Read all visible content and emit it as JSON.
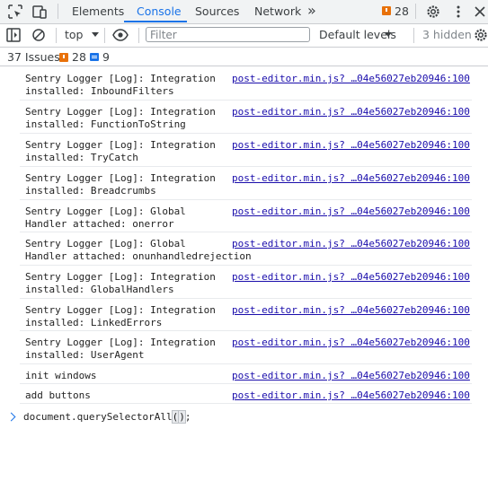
{
  "tabs": {
    "items": [
      {
        "label": "Elements"
      },
      {
        "label": "Console"
      },
      {
        "label": "Sources"
      },
      {
        "label": "Network"
      }
    ],
    "more": "»",
    "issue_badge_count": "28"
  },
  "toolbar": {
    "context": "top",
    "filter_placeholder": "Filter",
    "levels_label": "Default levels",
    "hidden_label": "3 hidden"
  },
  "issues": {
    "label": "37 Issues:",
    "warnings": "28",
    "info": "9"
  },
  "console": {
    "messages": [
      {
        "text": "Sentry Logger [Log]: Integration\ninstalled: InboundFilters",
        "source": "post-editor.min.js? …04e56027eb20946:100"
      },
      {
        "text": "Sentry Logger [Log]: Integration\ninstalled: FunctionToString",
        "source": "post-editor.min.js? …04e56027eb20946:100"
      },
      {
        "text": "Sentry Logger [Log]: Integration\ninstalled: TryCatch",
        "source": "post-editor.min.js? …04e56027eb20946:100"
      },
      {
        "text": "Sentry Logger [Log]: Integration\ninstalled: Breadcrumbs",
        "source": "post-editor.min.js? …04e56027eb20946:100"
      },
      {
        "text": "Sentry Logger [Log]: Global\nHandler attached: onerror",
        "source": "post-editor.min.js? …04e56027eb20946:100"
      },
      {
        "text": "Sentry Logger [Log]: Global\nHandler attached: onunhandledrejection",
        "source": "post-editor.min.js? …04e56027eb20946:100"
      },
      {
        "text": "Sentry Logger [Log]: Integration\ninstalled: GlobalHandlers",
        "source": "post-editor.min.js? …04e56027eb20946:100"
      },
      {
        "text": "Sentry Logger [Log]: Integration\ninstalled: LinkedErrors",
        "source": "post-editor.min.js? …04e56027eb20946:100"
      },
      {
        "text": "Sentry Logger [Log]: Integration\ninstalled: UserAgent",
        "source": "post-editor.min.js? …04e56027eb20946:100"
      },
      {
        "text": "init windows",
        "source": "post-editor.min.js? …04e56027eb20946:100"
      },
      {
        "text": "add buttons",
        "source": "post-editor.min.js? …04e56027eb20946:100"
      }
    ],
    "prompt": {
      "before": "document.querySelectorAll",
      "open_paren": "(",
      "close_paren": ")",
      "after": ";"
    }
  },
  "colors": {
    "accent": "#1a73e8",
    "warning": "#e8710a",
    "link": "#1a0dab"
  }
}
